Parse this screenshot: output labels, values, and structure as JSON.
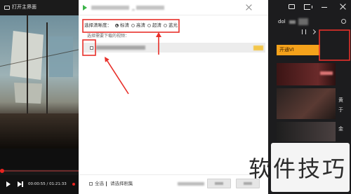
{
  "top_left": {
    "open_main_label": "打开主界面",
    "icon": "monitor-icon"
  },
  "player": {
    "current_time": "00:00:55",
    "time_separator": "/",
    "total_time": "01:21:33",
    "icons": [
      "play-icon",
      "next-icon",
      "record-dot-icon"
    ]
  },
  "dialog": {
    "icon": "play-logo-icon",
    "quality_label": "选择清晰度：",
    "quality_options": [
      {
        "label": "标清",
        "selected": true
      },
      {
        "label": "高清",
        "selected": false
      },
      {
        "label": "超清",
        "selected": false
      },
      {
        "label": "蓝光",
        "selected": false
      }
    ],
    "video_list_label": "选择需要下载的视频：",
    "select_all_label": "全选",
    "select_episodes_label": "请选择剧集"
  },
  "sidebar": {
    "icons": [
      "screen-icon",
      "cast-icon",
      "minimize-icon",
      "close-icon",
      "gear-icon",
      "pause-icon",
      "chevron-right-icon"
    ],
    "user_text": "dol",
    "vip_banner_label": "开通VI",
    "item_titles": [
      "黄",
      "于",
      "金"
    ]
  },
  "watermark": "软件技巧",
  "colors": {
    "accent": "#e8231f",
    "annotation": "#e8302a",
    "vip": "#f5a21b",
    "dialog_logo": "#3cb44a"
  }
}
